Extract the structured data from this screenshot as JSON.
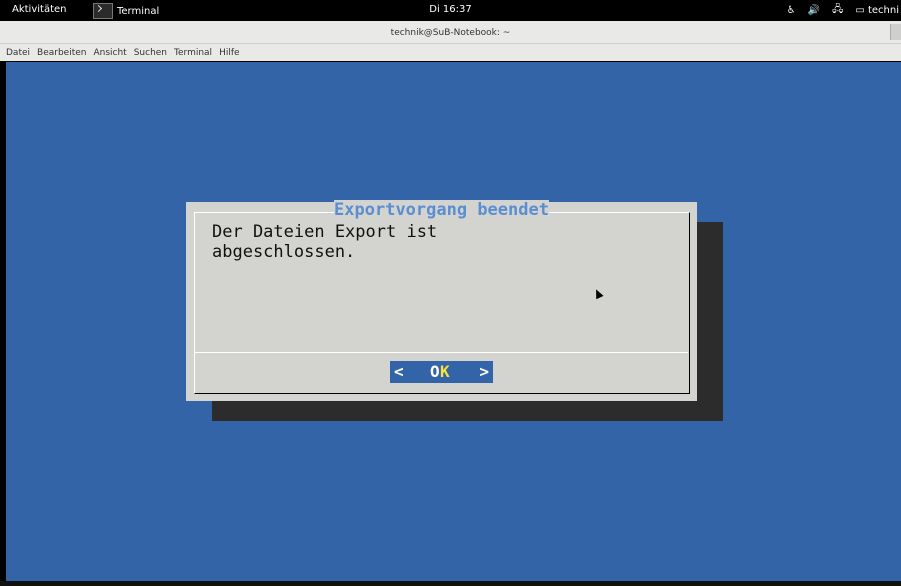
{
  "topbar": {
    "activities": "Aktivitäten",
    "app": "Terminal",
    "clock": "Di 16:37",
    "user": "techni"
  },
  "window": {
    "title": "technik@SuB-Notebook: ~"
  },
  "menu": [
    "Datei",
    "Bearbeiten",
    "Ansicht",
    "Suchen",
    "Terminal",
    "Hilfe"
  ],
  "dialog": {
    "title": "Exportvorgang beendet",
    "line1": "Der Dateien Export ist",
    "line2": "abgeschlossen.",
    "ok_left": "<",
    "ok_o": "O",
    "ok_k": "K",
    "ok_right": ">"
  },
  "colors": {
    "terminal_bg": "#3464a8",
    "dialog_bg": "#d3d4cf",
    "title_color": "#5b8ed1",
    "hotkey": "#f7e23a"
  }
}
